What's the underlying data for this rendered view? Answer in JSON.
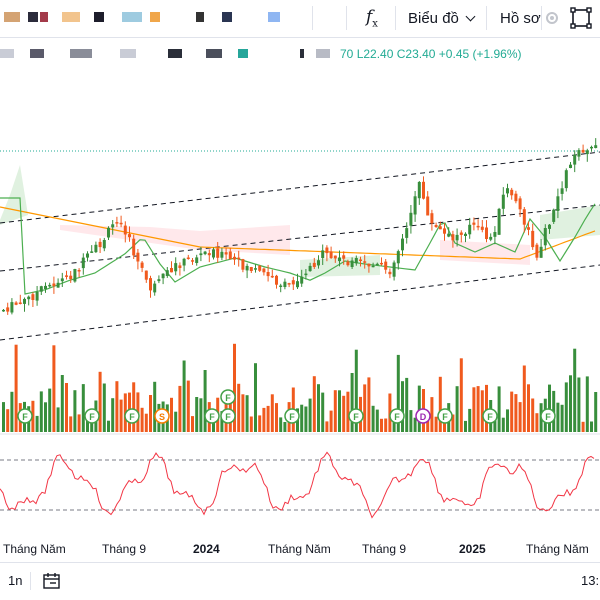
{
  "toolbar": {
    "function_icon": "fx-icon",
    "chart_type_label": "Biểu đồ",
    "profile_label": "Hồ sơ",
    "fullscreen_icon": "fullscreen-icon"
  },
  "legend": {
    "open_partial": "70",
    "low": "L22.40",
    "close": "C23.40",
    "change": "+0.45 (+1.96%)"
  },
  "colors": {
    "up": "#388e3c",
    "down": "#f05a1e",
    "ma_fast": "#4caf50",
    "ma_slow": "#ff9800",
    "rsi": "#f23645",
    "channel": "#131722"
  },
  "events": [
    "F",
    "F",
    "F",
    "S",
    "F",
    "F",
    "F",
    "F",
    "F",
    "D",
    "F",
    "F",
    "F",
    "F"
  ],
  "time_axis": [
    {
      "label": "Tháng Năm",
      "bold": false
    },
    {
      "label": "Tháng 9",
      "bold": false
    },
    {
      "label": "2024",
      "bold": true
    },
    {
      "label": "Tháng Năm",
      "bold": false
    },
    {
      "label": "Tháng 9",
      "bold": false
    },
    {
      "label": "2025",
      "bold": true
    },
    {
      "label": "Tháng Năm",
      "bold": false
    }
  ],
  "bottom": {
    "interval": "1n",
    "calendar_icon": "calendar-range-icon",
    "time": "13:"
  }
}
